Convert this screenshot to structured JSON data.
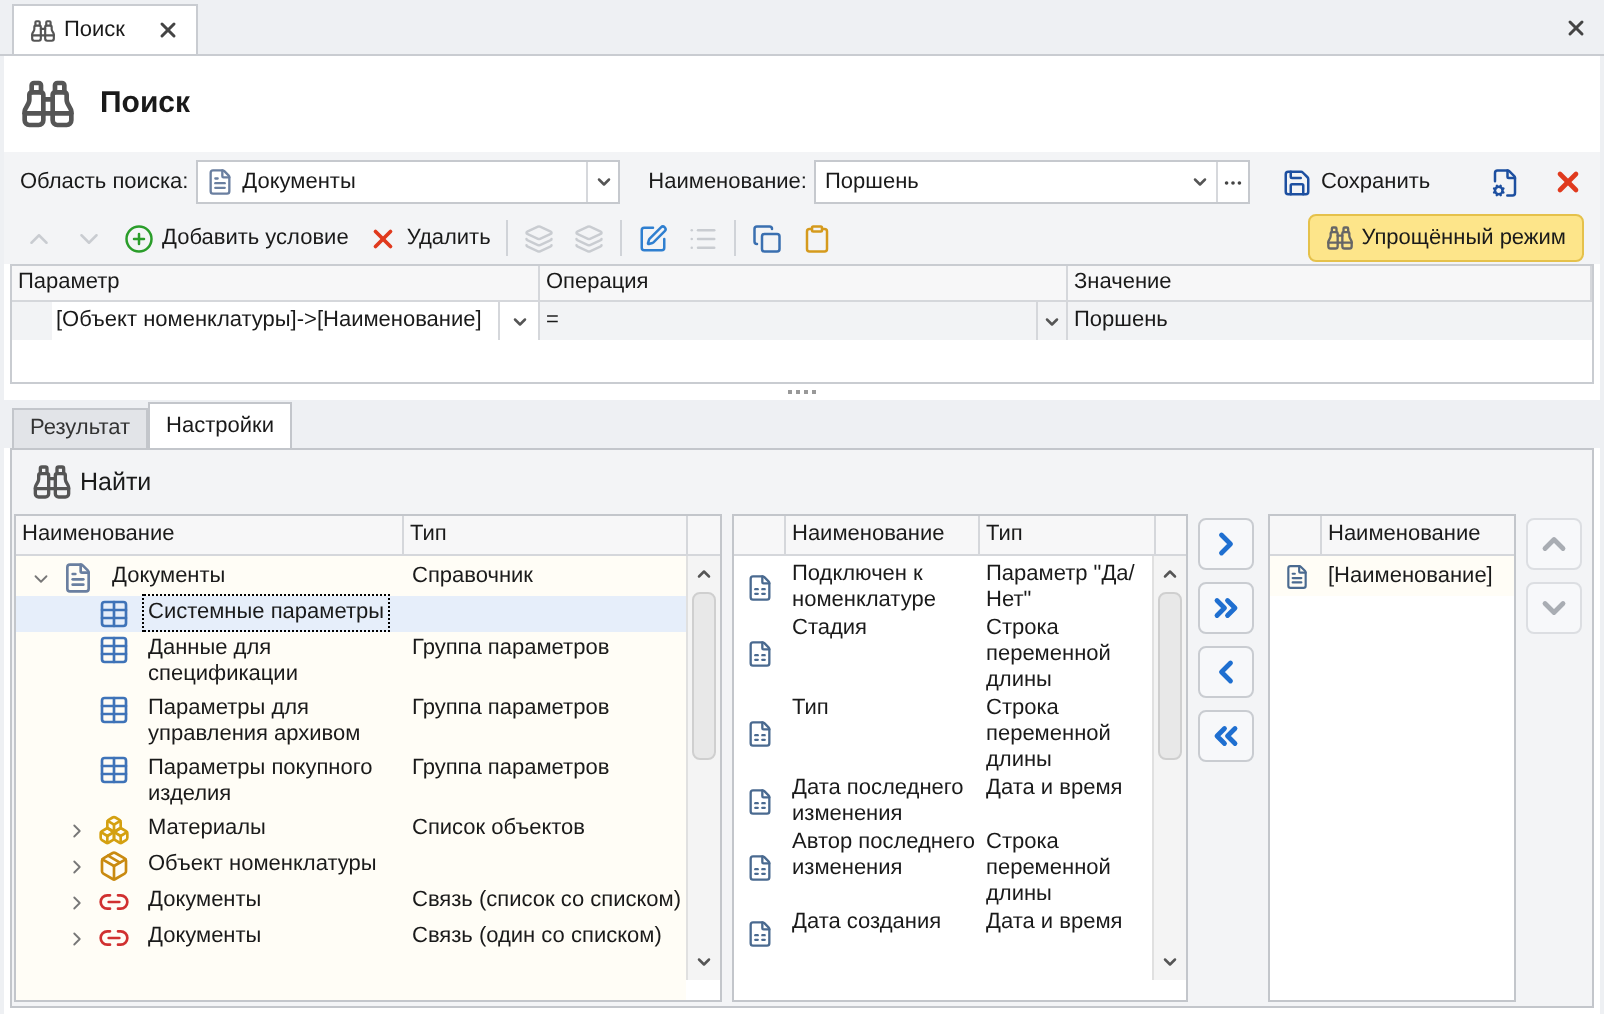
{
  "doc_tab": {
    "label": "Поиск",
    "selected": true
  },
  "header": {
    "title": "Поиск"
  },
  "search_bar": {
    "area_label": "Область поиска:",
    "area_value": "Документы",
    "name_label": "Наименование:",
    "name_value": "Поршень",
    "save_label": "Сохранить"
  },
  "toolbar": [
    {
      "kind": "up",
      "disabled": true
    },
    {
      "kind": "down",
      "disabled": true
    },
    {
      "kind": "add",
      "label": "Добавить условие",
      "disabled": false
    },
    {
      "kind": "delete",
      "label": "Удалить",
      "disabled": false
    },
    {
      "kind": "separator"
    },
    {
      "kind": "group",
      "disabled": true
    },
    {
      "kind": "ungroup",
      "disabled": true
    },
    {
      "kind": "separator"
    },
    {
      "kind": "edit",
      "disabled": false
    },
    {
      "kind": "list",
      "disabled": true
    },
    {
      "kind": "separator"
    },
    {
      "kind": "copy",
      "disabled": false
    },
    {
      "kind": "paste",
      "disabled": false
    }
  ],
  "simple_mode": {
    "label": "Упрощённый режим",
    "on": true
  },
  "conditions": {
    "columns": [
      "Параметр",
      "Операция",
      "Значение"
    ],
    "rows": [
      {
        "parameter": "[Объект номенклатуры]->[Наименование]",
        "operation": "=",
        "value": "Поршень"
      }
    ]
  },
  "tabs": [
    {
      "label": "Результат",
      "selected": false
    },
    {
      "label": "Настройки",
      "selected": true
    }
  ],
  "find_button": "Найти",
  "tree": {
    "columns": [
      "Наименование",
      "Тип"
    ],
    "items": [
      {
        "name": "Документы",
        "type": "Справочник",
        "kind": "document",
        "expanded": true,
        "selected": false,
        "children": [
          {
            "name": "Системные параметры",
            "kind": "table",
            "selected": true
          },
          {
            "name": "Данные для спецификации",
            "type": "Группа параметров",
            "kind": "table",
            "selected": false
          },
          {
            "name": "Параметры для управления архивом",
            "type": "Группа параметров",
            "kind": "table",
            "selected": false
          },
          {
            "name": "Параметры покупного изделия",
            "type": "Группа параметров",
            "kind": "table",
            "selected": false
          },
          {
            "name": "Материалы",
            "type": "Список объектов",
            "kind": "cubes",
            "expanded": false,
            "selected": false
          },
          {
            "name": "Объект номенклатуры",
            "kind": "box",
            "expanded": false,
            "selected": false
          },
          {
            "name": "Документы",
            "type": "Связь (список со списком)",
            "kind": "link",
            "expanded": false,
            "selected": false
          },
          {
            "name": "Документы",
            "type": "Связь (один со списком)",
            "kind": "link",
            "expanded": false,
            "selected": false
          }
        ]
      }
    ]
  },
  "fields": {
    "columns": [
      "Наименование",
      "Тип"
    ],
    "rows": [
      {
        "name": "Подключен к номенклатуре",
        "type": "Параметр \"Да/Нет\""
      },
      {
        "name": "Стадия",
        "type": "Строка переменной длины"
      },
      {
        "name": "Тип",
        "type": "Строка переменной длины"
      },
      {
        "name": "Дата последнего изменения",
        "type": "Дата и время"
      },
      {
        "name": "Автор последнего изменения",
        "type": "Строка переменной длины"
      },
      {
        "name": "Дата создания",
        "type": "Дата и время"
      }
    ]
  },
  "move_buttons": [
    {
      "kind": "add"
    },
    {
      "kind": "add_all"
    },
    {
      "kind": "remove"
    },
    {
      "kind": "remove_all"
    }
  ],
  "selected_fields": {
    "columns": [
      "Наименование"
    ],
    "rows": [
      "[Наименование]"
    ]
  },
  "order_buttons": [
    {
      "kind": "up"
    },
    {
      "kind": "down"
    }
  ]
}
